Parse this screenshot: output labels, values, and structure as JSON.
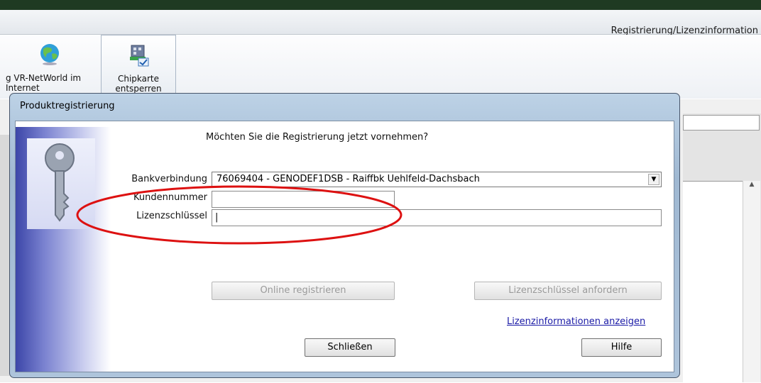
{
  "app": {
    "title": "Registrierung/Lizenzinformation"
  },
  "ribbon": {
    "buttons": [
      {
        "label": "g VR-NetWorld im Internet",
        "icon": "globe-icon"
      },
      {
        "label": "Chipkarte entsperren",
        "icon": "chipcard-icon"
      }
    ]
  },
  "dialog": {
    "title": "Produktregistrierung",
    "question": "Möchten Sie die Registrierung jetzt vornehmen?",
    "fields": {
      "bank_label": "Bankverbindung",
      "bank_value": "76069404 - GENODEF1DSB - Raiffbk Uehlfeld-Dachsbach",
      "kunden_label": "Kundennummer",
      "kunden_value": "",
      "lizenz_label": "Lizenzschlüssel",
      "lizenz_value": "|"
    },
    "buttons": {
      "online": "Online registrieren",
      "anfordern": "Lizenzschlüssel anfordern",
      "schliessen": "Schließen",
      "hilfe": "Hilfe"
    },
    "link": "Lizenzinformationen anzeigen"
  },
  "colors": {
    "annotation": "#dd1111",
    "title_bar": "#1f3a22",
    "link": "#1a1aa6"
  }
}
